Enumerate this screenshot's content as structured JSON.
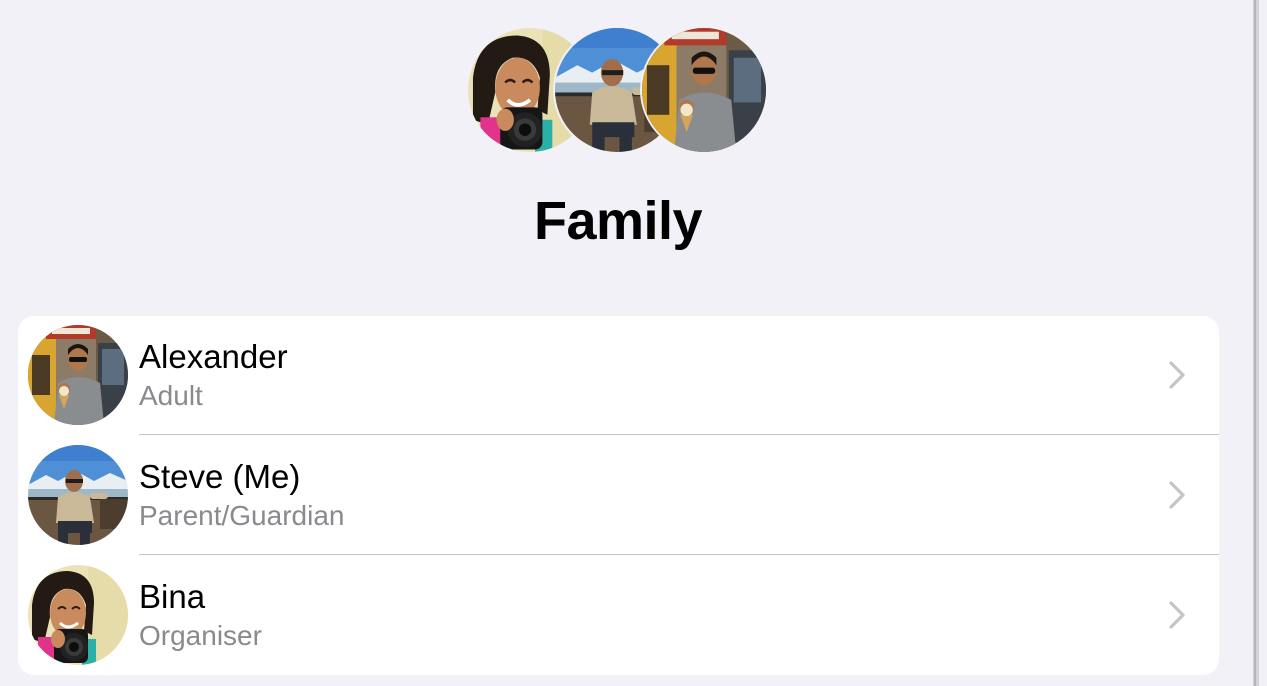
{
  "group": {
    "title": "Family",
    "header_avatars": [
      "bina-photo",
      "steve-photo",
      "alexander-photo"
    ]
  },
  "members": [
    {
      "name": "Alexander",
      "role": "Adult",
      "avatar": "alexander-photo"
    },
    {
      "name": "Steve (Me)",
      "role": "Parent/Guardian",
      "avatar": "steve-photo"
    },
    {
      "name": "Bina",
      "role": "Organiser",
      "avatar": "bina-photo"
    }
  ],
  "icons": {
    "row_disclosure": "chevron-right-icon"
  },
  "colors": {
    "background": "#f2f1f7",
    "card": "#ffffff",
    "secondary_text": "#8a8a8e",
    "chevron": "#c4c4c7",
    "divider": "#c8c7cc"
  }
}
